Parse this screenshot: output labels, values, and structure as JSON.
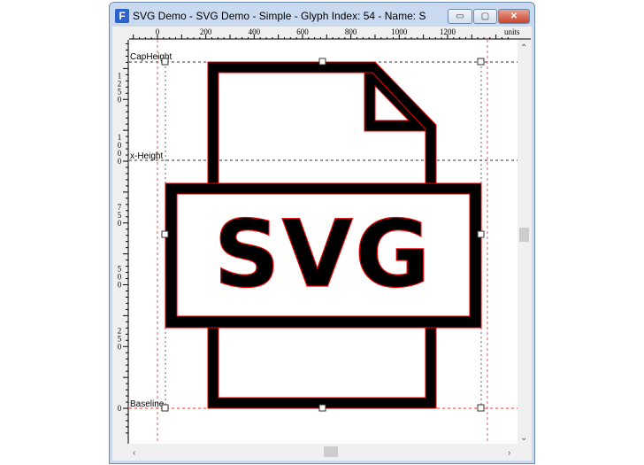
{
  "window": {
    "title": "SVG Demo - SVG Demo - Simple - Glyph Index: 54 - Name: S",
    "app_icon": "F",
    "minimize": "▭",
    "maximize": "▢",
    "close": "✕"
  },
  "ruler": {
    "top_labels": [
      "0",
      "200",
      "400",
      "600",
      "800",
      "1000",
      "1200"
    ],
    "top_values": [
      0,
      200,
      400,
      600,
      800,
      1000,
      1200
    ],
    "units": "units",
    "left_labels": [
      "1250",
      "1000",
      "750",
      "500",
      "250",
      "0"
    ],
    "left_values": [
      1250,
      1000,
      750,
      500,
      250,
      0
    ]
  },
  "metrics": {
    "cap_height_label": "CapHeight",
    "x_height_label": "x-Height",
    "baseline_label": "Baseline",
    "cap_height": 1400,
    "x_height": 1000,
    "baseline": 0
  },
  "glyph": {
    "text": "SVG"
  },
  "colors": {
    "outline": "#e00000",
    "fill": "#000000"
  }
}
